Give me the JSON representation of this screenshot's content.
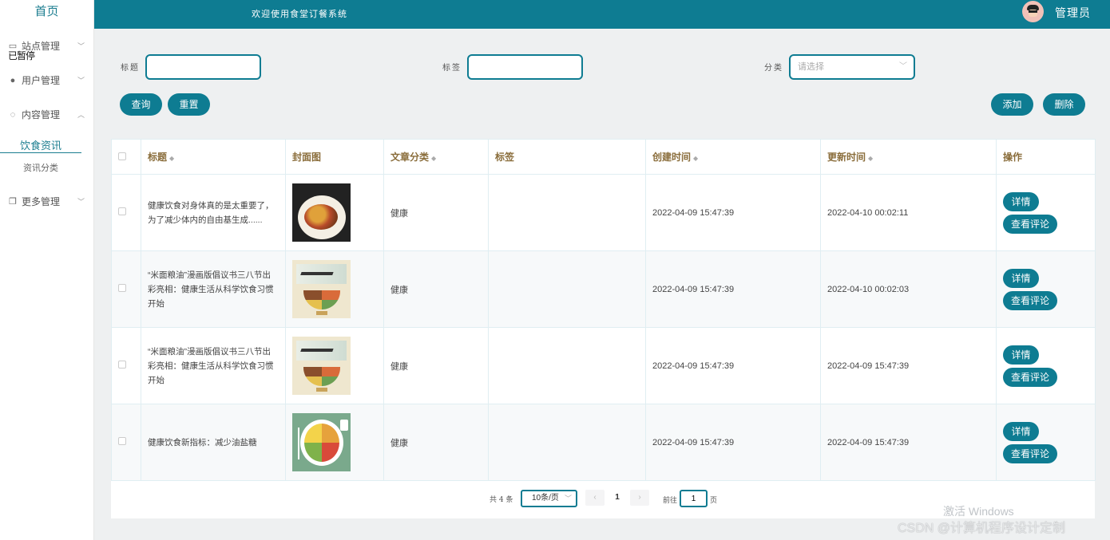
{
  "sidebar": {
    "home": "首页",
    "overlay": "已暂停",
    "menus": [
      {
        "label": "站点管理",
        "icon": "monitor-icon"
      },
      {
        "label": "用户管理",
        "icon": "user-icon"
      },
      {
        "label": "内容管理",
        "icon": "chat-icon"
      },
      {
        "label": "更多管理",
        "icon": "copy-icon"
      }
    ],
    "submenu": {
      "active": "饮食资讯",
      "other": "资讯分类"
    }
  },
  "header": {
    "welcome": "欢迎使用食堂订餐系统",
    "admin": "管理员"
  },
  "filters": {
    "title_label": "标题",
    "title_value": "",
    "tag_label": "标签",
    "tag_value": "",
    "category_label": "分类",
    "category_placeholder": "请选择",
    "query": "查询",
    "reset": "重置",
    "add": "添加",
    "delete": "删除"
  },
  "table": {
    "headers": {
      "title": "标题",
      "cover": "封面图",
      "category": "文章分类",
      "tag": "标签",
      "created": "创建时间",
      "updated": "更新时间",
      "actions": "操作"
    },
    "detail_label": "详情",
    "comment_label": "查看评论",
    "rows": [
      {
        "title": "健康饮食对身体真的是太重要了，为了减少体内的自由基生成......",
        "cover": "food-plate-image",
        "category": "健康",
        "tag": "",
        "created": "2022-04-09 15:47:39",
        "updated": "2022-04-10 00:02:11"
      },
      {
        "title": "“米面粮油”漫画版倡议书三八节出彩亮相：健康生活从科学饮食习惯开始",
        "cover": "poster-image",
        "category": "健康",
        "tag": "",
        "created": "2022-04-09 15:47:39",
        "updated": "2022-04-10 00:02:03"
      },
      {
        "title": "“米面粮油”漫画版倡议书三八节出彩亮相：健康生活从科学饮食习惯开始",
        "cover": "poster-image",
        "category": "健康",
        "tag": "",
        "created": "2022-04-09 15:47:39",
        "updated": "2022-04-09 15:47:39"
      },
      {
        "title": "健康饮食新指标：减少油盐糖",
        "cover": "plate-diagram-image",
        "category": "健康",
        "tag": "",
        "created": "2022-04-09 15:47:39",
        "updated": "2022-04-09 15:47:39"
      }
    ]
  },
  "pagination": {
    "total": "共 4 条",
    "page_size": "10条/页",
    "prev": "‹",
    "current": "1",
    "next": "›",
    "goto_label": "前往",
    "goto_value": "1",
    "page_suffix": "页"
  },
  "watermark": {
    "windows": "激活 Windows",
    "csdn": "CSDN @计算机程序设计定制"
  },
  "colors": {
    "primary": "#0e7c92",
    "header_text": "#8a6d3b"
  }
}
